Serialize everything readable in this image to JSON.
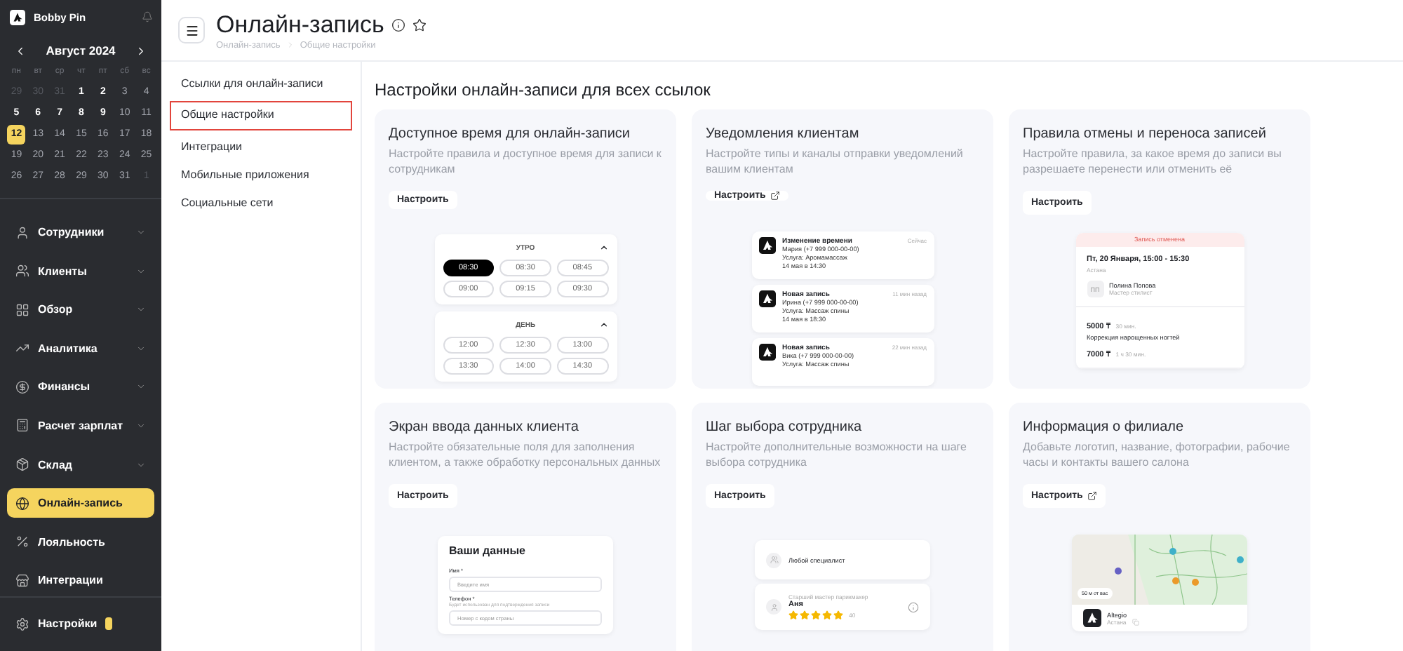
{
  "sidebar": {
    "brand": "Bobby Pin",
    "calendar": {
      "month": "Август 2024",
      "weekdays": [
        "пн",
        "вт",
        "ср",
        "чт",
        "пт",
        "сб",
        "вс"
      ],
      "days": [
        {
          "label": "29",
          "kind": "other",
          "selected": false
        },
        {
          "label": "30",
          "kind": "other",
          "selected": false
        },
        {
          "label": "31",
          "kind": "other",
          "selected": false
        },
        {
          "label": "1",
          "kind": "busy",
          "selected": false
        },
        {
          "label": "2",
          "kind": "busy",
          "selected": false
        },
        {
          "label": "3",
          "kind": "free",
          "selected": false
        },
        {
          "label": "4",
          "kind": "free",
          "selected": false
        },
        {
          "label": "5",
          "kind": "busy",
          "selected": false
        },
        {
          "label": "6",
          "kind": "busy",
          "selected": false
        },
        {
          "label": "7",
          "kind": "busy",
          "selected": false
        },
        {
          "label": "8",
          "kind": "busy",
          "selected": false
        },
        {
          "label": "9",
          "kind": "busy",
          "selected": false
        },
        {
          "label": "10",
          "kind": "free",
          "selected": false
        },
        {
          "label": "11",
          "kind": "free",
          "selected": false
        },
        {
          "label": "12",
          "kind": "free",
          "selected": true
        },
        {
          "label": "13",
          "kind": "free",
          "selected": false
        },
        {
          "label": "14",
          "kind": "free",
          "selected": false
        },
        {
          "label": "15",
          "kind": "free",
          "selected": false
        },
        {
          "label": "16",
          "kind": "free",
          "selected": false
        },
        {
          "label": "17",
          "kind": "free",
          "selected": false
        },
        {
          "label": "18",
          "kind": "free",
          "selected": false
        },
        {
          "label": "19",
          "kind": "free",
          "selected": false
        },
        {
          "label": "20",
          "kind": "free",
          "selected": false
        },
        {
          "label": "21",
          "kind": "free",
          "selected": false
        },
        {
          "label": "22",
          "kind": "free",
          "selected": false
        },
        {
          "label": "23",
          "kind": "free",
          "selected": false
        },
        {
          "label": "24",
          "kind": "free",
          "selected": false
        },
        {
          "label": "25",
          "kind": "free",
          "selected": false
        },
        {
          "label": "26",
          "kind": "free",
          "selected": false
        },
        {
          "label": "27",
          "kind": "free",
          "selected": false
        },
        {
          "label": "28",
          "kind": "free",
          "selected": false
        },
        {
          "label": "29",
          "kind": "free",
          "selected": false
        },
        {
          "label": "30",
          "kind": "free",
          "selected": false
        },
        {
          "label": "31",
          "kind": "free",
          "selected": false
        },
        {
          "label": "1",
          "kind": "other",
          "selected": false
        }
      ]
    },
    "nav": [
      {
        "label": "Сотрудники",
        "expandable": true,
        "selected": false
      },
      {
        "label": "Клиенты",
        "expandable": true,
        "selected": false
      },
      {
        "label": "Обзор",
        "expandable": true,
        "selected": false
      },
      {
        "label": "Аналитика",
        "expandable": true,
        "selected": false
      },
      {
        "label": "Финансы",
        "expandable": true,
        "selected": false
      },
      {
        "label": "Расчет зарплат",
        "expandable": true,
        "selected": false
      },
      {
        "label": "Склад",
        "expandable": true,
        "selected": false
      },
      {
        "label": "Онлайн-запись",
        "expandable": false,
        "selected": true
      },
      {
        "label": "Лояльность",
        "expandable": false,
        "selected": false
      },
      {
        "label": "Интеграции",
        "expandable": false,
        "selected": false
      }
    ],
    "settings": {
      "label": "Настройки"
    }
  },
  "header": {
    "title": "Онлайн-запись",
    "breadcrumbs": [
      "Онлайн-запись",
      "Общие настройки"
    ]
  },
  "submenu": [
    {
      "label": "Ссылки для онлайн-записи",
      "selected": false
    },
    {
      "label": "Общие настройки",
      "selected": true
    },
    {
      "label": "Интеграции",
      "selected": false
    },
    {
      "label": "Мобильные приложения",
      "selected": false
    },
    {
      "label": "Социальные сети",
      "selected": false
    }
  ],
  "main": {
    "heading": "Настройки онлайн-записи для всех ссылок",
    "cards": [
      {
        "title": "Доступное время для онлайн-записи",
        "description": "Настройте правила и доступное время для записи к сотрудникам",
        "button": {
          "label": "Настроить",
          "external": false
        },
        "preview": {
          "kind": "slots",
          "groups": [
            {
              "label": "УТРО",
              "slots": [
                {
                  "label": "08:30",
                  "selected": true
                },
                {
                  "label": "08:30",
                  "selected": false
                },
                {
                  "label": "08:45",
                  "selected": false
                },
                {
                  "label": "09:00",
                  "selected": false
                },
                {
                  "label": "09:15",
                  "selected": false
                },
                {
                  "label": "09:30",
                  "selected": false
                }
              ]
            },
            {
              "label": "ДЕНЬ",
              "slots": [
                {
                  "label": "12:00",
                  "selected": false
                },
                {
                  "label": "12:30",
                  "selected": false
                },
                {
                  "label": "13:00",
                  "selected": false
                },
                {
                  "label": "13:30",
                  "selected": false
                },
                {
                  "label": "14:00",
                  "selected": false
                },
                {
                  "label": "14:30",
                  "selected": false
                }
              ]
            }
          ]
        }
      },
      {
        "title": "Уведомления клиентам",
        "description": "Настройте типы и каналы отправки уведомлений вашим клиентам",
        "button": {
          "label": "Настроить",
          "external": true
        },
        "preview": {
          "kind": "notifications",
          "items": [
            {
              "title": "Изменение времени",
              "time": "Сейчас",
              "lines": [
                "Мария (+7 999 000-00-00)",
                "Услуга: Аромамассаж",
                "14 мая в 14:30"
              ]
            },
            {
              "title": "Новая запись",
              "time": "11 мин назад",
              "lines": [
                "Ирина (+7 999 000-00-00)",
                "Услуга: Массаж спины",
                "14 мая в 18:30"
              ]
            },
            {
              "title": "Новая запись",
              "time": "22 мин назад",
              "lines": [
                "Вика (+7 999 000-00-00)",
                "Услуга: Массаж спины"
              ]
            }
          ]
        }
      },
      {
        "title": "Правила отмены и переноса записей",
        "description": "Настройте правила, за какое время до записи вы разрешаете перенести или отменить её",
        "button": {
          "label": "Настроить",
          "external": false
        },
        "preview": {
          "kind": "cancellation",
          "banner": "Запись отменена",
          "date": "Пт, 20 Января, 15:00 - 15:30",
          "city": "Астана",
          "initials": "ПП",
          "name": "Полина Попова",
          "role": "Мастер стилист",
          "lines": [
            {
              "kind": "price",
              "price": "5000 ₸",
              "duration": "30 мин."
            },
            {
              "kind": "service",
              "text": "Коррекция нарощенных ногтей"
            },
            {
              "kind": "price",
              "price": "7000 ₸",
              "duration": "1 ч 30 мин."
            }
          ]
        }
      },
      {
        "title": "Экран ввода данных клиента",
        "description": "Настройте обязательные поля для заполнения клиентом, а также обработку персональных данных",
        "button": {
          "label": "Настроить",
          "external": false
        },
        "preview": {
          "kind": "form",
          "title": "Ваши данные",
          "fields": [
            {
              "label": "Имя *",
              "placeholder": "Введите имя"
            },
            {
              "label": "Телефон *",
              "hint": "Будет использован для подтверждения записи",
              "placeholder": "Номер с кодом страны"
            }
          ]
        }
      },
      {
        "title": "Шаг выбора сотрудника",
        "description": "Настройте дополнительные возможности на шаге выбора сотрудника",
        "button": {
          "label": "Настроить",
          "external": false
        },
        "preview": {
          "kind": "staff",
          "items": [
            {
              "kind": "any",
              "name": "Любой специалист"
            },
            {
              "kind": "person",
              "role": "Старший мастер парикмахер",
              "name": "Аня",
              "stars": 5,
              "rating": "40"
            }
          ]
        }
      },
      {
        "title": "Информация о филиале",
        "description": "Добавьте логотип, название, фотографии, рабочие часы и контакты вашего салона",
        "button": {
          "label": "Настроить",
          "external": true
        },
        "preview": {
          "kind": "branch",
          "distance": "50 м от вас",
          "name": "Altegio",
          "city": "Астана"
        }
      }
    ]
  }
}
